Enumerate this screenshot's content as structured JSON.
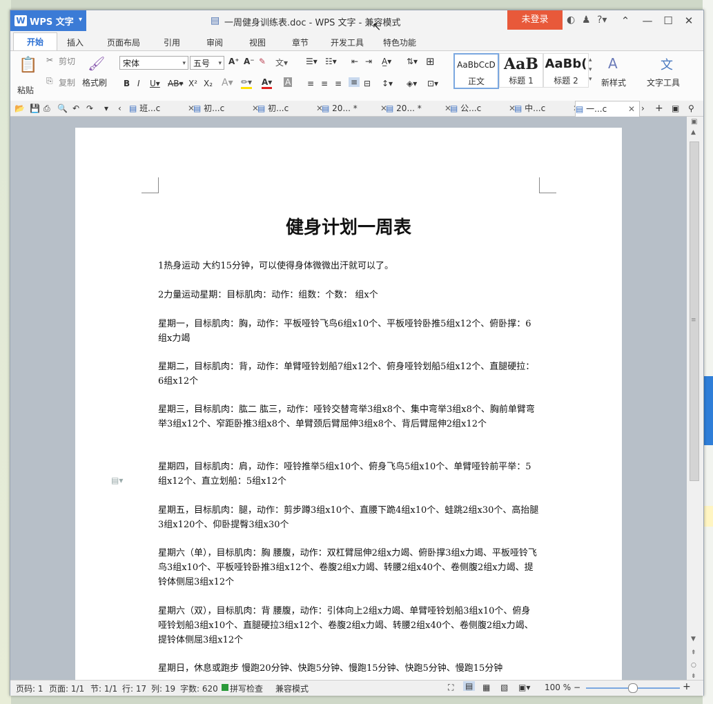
{
  "window": {
    "app_name": "WPS 文字",
    "title": "一周健身训练表.doc - WPS 文字 - 兼容模式",
    "login_label": "未登录"
  },
  "ribbon_tabs": [
    "开始",
    "插入",
    "页面布局",
    "引用",
    "审阅",
    "视图",
    "章节",
    "开发工具",
    "特色功能"
  ],
  "ribbon": {
    "paste": "粘贴",
    "cut": "剪切",
    "copy": "复制",
    "format_painter": "格式刷",
    "font_name": "宋体",
    "font_size": "五号",
    "styles": [
      {
        "sample": "AaBbCcD",
        "name": "正文"
      },
      {
        "sample": "AaB",
        "name": "标题 1"
      },
      {
        "sample": "AaBb(",
        "name": "标题 2"
      }
    ],
    "new_style": "新样式",
    "text_tools": "文字工具"
  },
  "doc_tabs": [
    {
      "label": "班...c",
      "active": false
    },
    {
      "label": "初...c",
      "active": false
    },
    {
      "label": "初...c",
      "active": false
    },
    {
      "label": "20... *",
      "active": false
    },
    {
      "label": "20... *",
      "active": false
    },
    {
      "label": "公...c",
      "active": false
    },
    {
      "label": "中...c",
      "active": false
    },
    {
      "label": "一...c",
      "active": true
    }
  ],
  "document": {
    "title": "健身计划一周表",
    "paragraphs": [
      "1热身运动 大约15分钟，可以使得身体微微出汗就可以了。",
      "2力量运动星期：目标肌肉：动作：组数：个数： 组x个",
      "星期一，目标肌肉：胸，动作：平板哑铃飞鸟6组x10个、平板哑铃卧推5组x12个、俯卧撑：6组x力竭",
      "星期二，目标肌肉：背，动作：单臂哑铃划船7组x12个、俯身哑铃划船5组x12个、直腿硬拉：6组x12个",
      "星期三，目标肌肉：肱二 肱三，动作：哑铃交替弯举3组x8个、集中弯举3组x8个、胸前单臂弯举3组x12个、窄距卧推3组x8个、单臂颈后臂屈伸3组x8个、背后臂屈伸2组x12个",
      "星期四，目标肌肉：肩，动作：哑铃推举5组x10个、俯身飞鸟5组x10个、单臂哑铃前平举：5组x12个、直立划船：5组x12个",
      "星期五，目标肌肉：腿，动作：剪步蹲3组x10个、直腰下跪4组x10个、蛙跳2组x30个、高抬腿3组x120个、仰卧提臀3组x30个",
      "星期六（单），目标肌肉：胸 腰腹，动作：双杠臂屈伸2组x力竭、俯卧撑3组x力竭、平板哑铃飞鸟3组x10个、平板哑铃卧推3组x12个、卷腹2组x力竭、转腰2组x40个、卷侧腹2组x力竭、提铃体侧屈3组x12个",
      "星期六（双），目标肌肉：背 腰腹，动作：引体向上2组x力竭、单臂哑铃划船3组x10个、俯身哑铃划船3组x10个、直腿硬拉3组x12个、卷腹2组x力竭、转腰2组x40个、卷侧腹2组x力竭、提铃体侧屈3组x12个",
      "星期日，休息或跑步 慢跑20分钟、快跑5分钟、慢跑15分钟、快跑5分钟、慢跑15分钟"
    ]
  },
  "status": {
    "page": "页码: 1",
    "pages": "页面: 1/1",
    "section": "节: 1/1",
    "row": "行: 17",
    "col": "列: 19",
    "wordcount": "字数: 620",
    "spellcheck": "拼写检查",
    "mode": "兼容模式",
    "zoom": "100 %"
  }
}
